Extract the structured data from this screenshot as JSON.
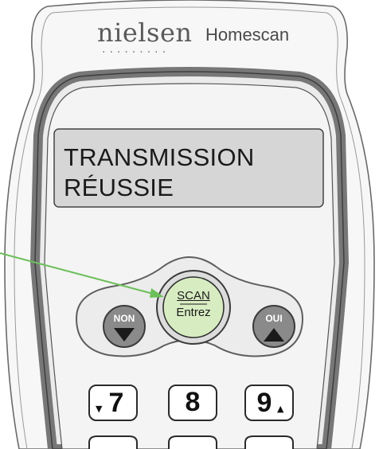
{
  "device": {
    "brand": "nielsen",
    "brand_dots": "·········",
    "product": "Homescan"
  },
  "display": {
    "line1": "TRANSMISSION",
    "line2": "RÉUSSIE"
  },
  "buttons": {
    "scan_top": "SCAN",
    "scan_bottom": "Entrez",
    "non": "NON",
    "oui": "OUI"
  },
  "keypad": [
    {
      "label": "7",
      "arrow": "▼"
    },
    {
      "label": "8",
      "arrow": ""
    },
    {
      "label": "9",
      "arrow": "▲"
    }
  ],
  "colors": {
    "scan_button": "#d8ecc2",
    "callout_arrow": "#6cbf5a",
    "side_buttons": "#8a8a8a",
    "lcd": "#d6d6d6"
  }
}
